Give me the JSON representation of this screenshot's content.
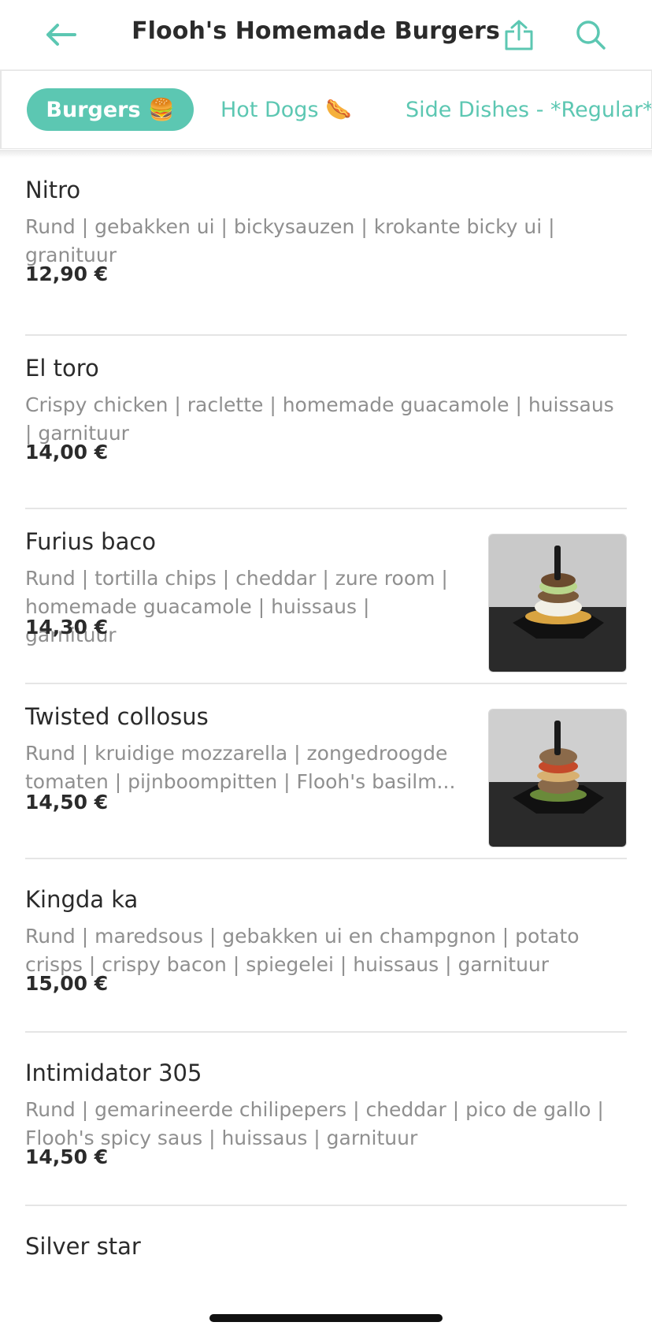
{
  "header": {
    "title": "Flooh's Homemade Burgers",
    "back_icon": "arrow-left-icon",
    "share_icon": "share-icon",
    "search_icon": "search-icon",
    "accent": "#5cc7b2"
  },
  "tabs": [
    {
      "label": "Burgers 🍔",
      "active": true
    },
    {
      "label": "Hot Dogs 🌭",
      "active": false
    },
    {
      "label": "Side Dishes - *Regular*",
      "active": false
    }
  ],
  "menu": {
    "items": [
      {
        "name": "Nitro",
        "description": "Rund | gebakken ui | bickysauzen | krokante bicky ui | granituur",
        "price": "12,90 €"
      },
      {
        "name": "El toro",
        "description": "Crispy chicken | raclette | homemade guacamole | huissaus | garnituur",
        "price": "14,00 €"
      },
      {
        "name": "Furius baco",
        "description": "Rund | tortilla chips | cheddar | zure room | homemade guacamole | huissaus | garnituur",
        "price": "14,30 €",
        "image": "burger-photo"
      },
      {
        "name": "Twisted collosus",
        "description": "Rund | kruidige mozzarella | zongedroogde tomaten | pijnboompitten | Flooh's basilm...",
        "price": "14,50 €",
        "image": "burger-photo"
      },
      {
        "name": "Kingda ka",
        "description": "Rund | maredsous | gebakken ui en champgnon | potato crisps | crispy bacon | spiegelei | huissaus | garnituur",
        "price": "15,00 €"
      },
      {
        "name": "Intimidator 305",
        "description": "Rund | gemarineerde chilipepers | cheddar | pico de gallo | Flooh's spicy saus | huissaus | garnituur",
        "price": "14,50 €"
      },
      {
        "name": "Silver star",
        "description": "",
        "price": ""
      }
    ]
  }
}
